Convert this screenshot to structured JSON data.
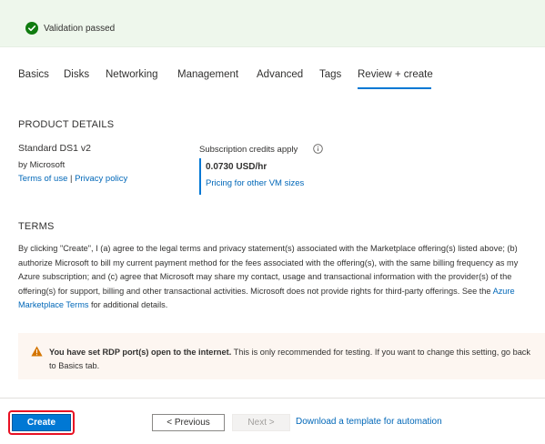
{
  "validation": {
    "text": "Validation passed",
    "color": "#107c10"
  },
  "tabs": [
    {
      "label": "Basics",
      "selected": false
    },
    {
      "label": "Disks",
      "selected": false
    },
    {
      "label": "Networking",
      "selected": false
    },
    {
      "label": "Management",
      "selected": false
    },
    {
      "label": "Advanced",
      "selected": false
    },
    {
      "label": "Tags",
      "selected": false
    },
    {
      "label": "Review + create",
      "selected": true
    }
  ],
  "product": {
    "heading": "PRODUCT DETAILS",
    "name": "Standard DS1 v2",
    "publisher": "by Microsoft",
    "terms_link": "Terms of use",
    "separator": "|",
    "privacy_link": "Privacy policy",
    "credits_label": "Subscription credits apply",
    "price": "0.0730 USD/hr",
    "pricing_link": "Pricing for other VM sizes"
  },
  "terms": {
    "heading": "TERMS",
    "body_before": "By clicking \"Create\", I (a) agree to the legal terms and privacy statement(s) associated with the Marketplace offering(s) listed above; (b) authorize Microsoft to bill my current payment method for the fees associated with the offering(s), with the same billing frequency as my Azure subscription; and (c) agree that Microsoft may share my contact, usage and transactional information with the provider(s) of the offering(s) for support, billing and other transactional activities. Microsoft does not provide rights for third-party offerings. See the ",
    "link": "Azure Marketplace Terms",
    "body_after": " for additional details."
  },
  "warning": {
    "bold": "You have set RDP port(s) open to the internet.",
    "text": " This is only recommended for testing.  If you want to change this setting, go back to Basics tab.",
    "color": "#d47500"
  },
  "footer": {
    "create_label": "Create",
    "previous_label": "< Previous",
    "next_label": "Next >",
    "download_link": "Download a template for automation",
    "accent": "#0078d4",
    "highlight": "#e81123"
  }
}
